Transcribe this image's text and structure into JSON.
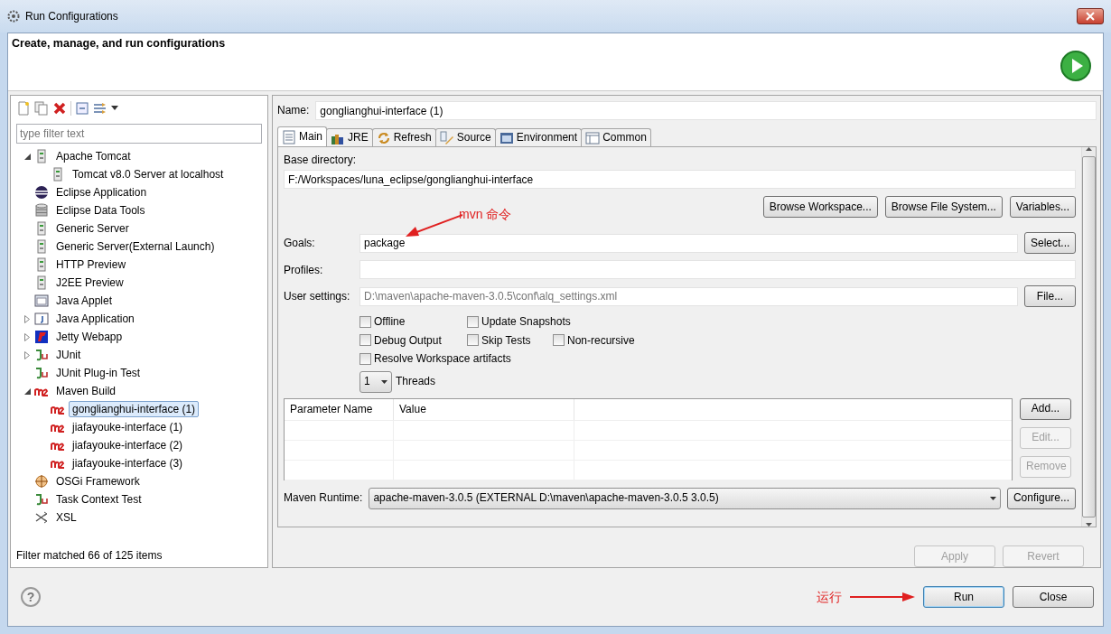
{
  "window": {
    "title": "Run Configurations"
  },
  "header": {
    "title": "Create, manage, and run configurations"
  },
  "filter": {
    "placeholder": "type filter text"
  },
  "tree": [
    {
      "label": "Apache Tomcat",
      "kind": "server",
      "expanded": true,
      "selected": false,
      "children": [
        {
          "label": "Tomcat v8.0 Server at localhost",
          "kind": "server",
          "selected": false
        }
      ]
    },
    {
      "label": "Eclipse Application",
      "kind": "eclipse",
      "selected": false
    },
    {
      "label": "Eclipse Data Tools",
      "kind": "database",
      "selected": false
    },
    {
      "label": "Generic Server",
      "kind": "server",
      "selected": false
    },
    {
      "label": "Generic Server(External Launch)",
      "kind": "server",
      "selected": false
    },
    {
      "label": "HTTP Preview",
      "kind": "server",
      "selected": false
    },
    {
      "label": "J2EE Preview",
      "kind": "server",
      "selected": false
    },
    {
      "label": "Java Applet",
      "kind": "applet",
      "selected": false
    },
    {
      "label": "Java Application",
      "kind": "java",
      "expanded": false,
      "selected": false
    },
    {
      "label": "Jetty Webapp",
      "kind": "jetty",
      "expanded": false,
      "selected": false
    },
    {
      "label": "JUnit",
      "kind": "junit",
      "expanded": false,
      "selected": false
    },
    {
      "label": "JUnit Plug-in Test",
      "kind": "junit",
      "selected": false
    },
    {
      "label": "Maven Build",
      "kind": "maven",
      "expanded": true,
      "selected": false,
      "children": [
        {
          "label": "gonglianghui-interface (1)",
          "kind": "maven",
          "selected": true
        },
        {
          "label": "jiafayouke-interface (1)",
          "kind": "maven",
          "selected": false
        },
        {
          "label": "jiafayouke-interface (2)",
          "kind": "maven",
          "selected": false
        },
        {
          "label": "jiafayouke-interface (3)",
          "kind": "maven",
          "selected": false
        }
      ]
    },
    {
      "label": "OSGi Framework",
      "kind": "osgi",
      "selected": false
    },
    {
      "label": "Task Context Test",
      "kind": "junit",
      "selected": false
    },
    {
      "label": "XSL",
      "kind": "xsl",
      "selected": false
    }
  ],
  "filter_status": "Filter matched 66 of 125 items",
  "name": {
    "label": "Name:",
    "value": "gonglianghui-interface (1)"
  },
  "tabs": [
    {
      "label": "Main",
      "kind": "main",
      "selected": true
    },
    {
      "label": "JRE",
      "kind": "jre",
      "selected": false
    },
    {
      "label": "Refresh",
      "kind": "refresh",
      "selected": false
    },
    {
      "label": "Source",
      "kind": "source",
      "selected": false
    },
    {
      "label": "Environment",
      "kind": "environment",
      "selected": false
    },
    {
      "label": "Common",
      "kind": "common",
      "selected": false
    }
  ],
  "base_directory": {
    "label": "Base directory:",
    "value": "F:/Workspaces/luna_eclipse/gonglianghui-interface",
    "buttons": [
      {
        "label": "Browse Workspace...",
        "disabled": false
      },
      {
        "label": "Browse File System...",
        "disabled": false
      },
      {
        "label": "Variables...",
        "disabled": false
      }
    ]
  },
  "fields": [
    {
      "label": "Goals:",
      "value": "package",
      "button": "Select...",
      "annotation": "mvn 命令"
    },
    {
      "label": "Profiles:"
    },
    {
      "label": "User settings:",
      "placeholder": "D:\\maven\\apache-maven-3.0.5\\conf\\alq_settings.xml",
      "button": "File..."
    }
  ],
  "options": [
    [
      {
        "label": "Offline",
        "checked": false
      },
      {
        "label": "Update Snapshots",
        "checked": false
      }
    ],
    [
      {
        "label": "Debug Output",
        "checked": false
      },
      {
        "label": "Skip Tests",
        "checked": false
      },
      {
        "label": "Non-recursive",
        "checked": false
      }
    ],
    [
      {
        "label": "Resolve Workspace artifacts",
        "checked": false
      }
    ]
  ],
  "threads": {
    "value": "1",
    "label": "Threads"
  },
  "parameters": {
    "columns": [
      "Parameter Name",
      "Value"
    ],
    "buttons": [
      {
        "label": "Add...",
        "disabled": false
      },
      {
        "label": "Edit...",
        "disabled": true
      },
      {
        "label": "Remove",
        "disabled": true
      }
    ]
  },
  "runtime": {
    "label": "Maven Runtime:",
    "value": "apache-maven-3.0.5 (EXTERNAL D:\\maven\\apache-maven-3.0.5 3.0.5)",
    "button": "Configure..."
  },
  "config_buttons": [
    {
      "label": "Apply",
      "disabled": true
    },
    {
      "label": "Revert",
      "disabled": true
    }
  ],
  "footer": {
    "help": "?",
    "annotation": "运行",
    "buttons": [
      {
        "label": "Run",
        "default": true
      },
      {
        "label": "Close",
        "default": false
      }
    ]
  }
}
